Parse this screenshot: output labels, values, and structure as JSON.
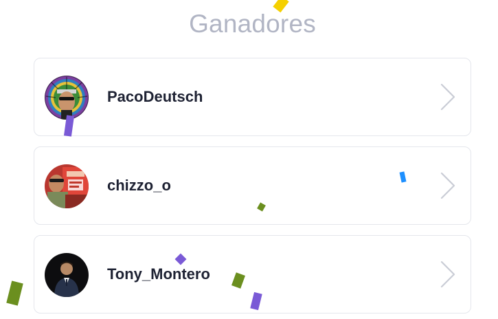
{
  "header": {
    "title": "Ganadores"
  },
  "winners": [
    {
      "username": "PacoDeutsch",
      "avatar_icon": "avatar-headdress-icon"
    },
    {
      "username": "chizzo_o",
      "avatar_icon": "avatar-photo-icon"
    },
    {
      "username": "Tony_Montero",
      "avatar_icon": "avatar-suit-icon"
    }
  ],
  "icons": {
    "row_action": "chevron-right-icon"
  },
  "colors": {
    "title": "#b1b5c4",
    "username": "#1e2233",
    "card_border": "#e4e6ec",
    "chevron": "#c9ccd5",
    "confetti": [
      "#f5d000",
      "#7a5ad6",
      "#1e90ff",
      "#6b8f1f"
    ]
  }
}
